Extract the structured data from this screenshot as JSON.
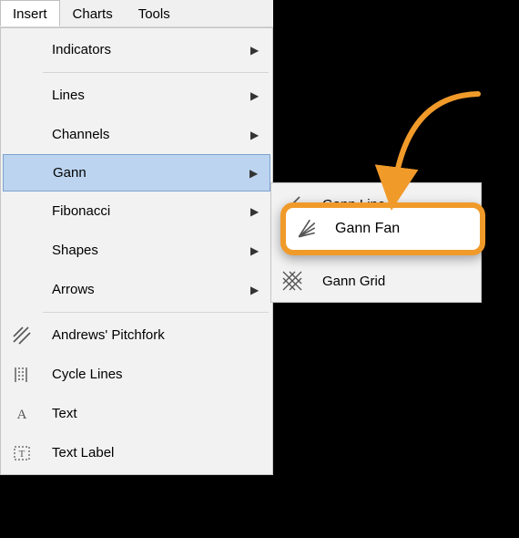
{
  "menubar": {
    "items": [
      {
        "label": "Insert",
        "open": true
      },
      {
        "label": "Charts"
      },
      {
        "label": "Tools"
      }
    ]
  },
  "dropdown": {
    "groups": [
      [
        {
          "label": "Indicators",
          "submenu": true
        }
      ],
      [
        {
          "label": "Lines",
          "submenu": true
        },
        {
          "label": "Channels",
          "submenu": true
        },
        {
          "label": "Gann",
          "submenu": true,
          "highlight": true
        },
        {
          "label": "Fibonacci",
          "submenu": true
        },
        {
          "label": "Shapes",
          "submenu": true
        },
        {
          "label": "Arrows",
          "submenu": true
        }
      ],
      [
        {
          "label": "Andrews' Pitchfork",
          "icon": "pitchfork"
        },
        {
          "label": "Cycle Lines",
          "icon": "cycle"
        },
        {
          "label": "Text",
          "icon": "text"
        },
        {
          "label": "Text Label",
          "icon": "textlabel"
        }
      ]
    ]
  },
  "submenu": {
    "items": [
      {
        "label": "Gann Line",
        "icon": "gann-line"
      },
      {
        "label": "Gann Fan",
        "icon": "gann-fan"
      },
      {
        "label": "Gann Grid",
        "icon": "gann-grid"
      }
    ]
  },
  "callout": {
    "label": "Gann Fan",
    "icon": "gann-fan"
  },
  "colors": {
    "highlight_bg": "#bcd4ef",
    "highlight_border": "#7da2ce",
    "callout_border": "#f09a2a"
  }
}
